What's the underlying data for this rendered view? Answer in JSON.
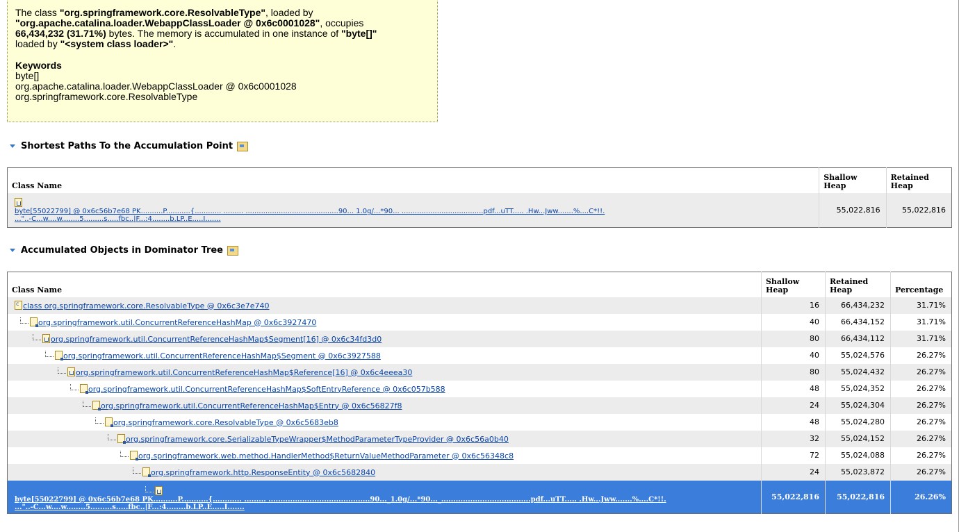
{
  "summary": {
    "p1_a": "The class ",
    "p1_cls": "\"org.springframework.core.ResolvableType\"",
    "p1_b": ", loaded by",
    "p1_loader": "\"org.apache.catalina.loader.WebappClassLoader @ 0x6c0001028\"",
    "p1_c": ", occupies",
    "p1_bytes": "66,434,232 (31.71%)",
    "p1_d": " bytes. The memory is accumulated in one instance of ",
    "p1_type": "\"byte[]\"",
    "p1_e": "loaded by ",
    "p1_syscl": "\"<system class loader>\"",
    "p1_f": ".",
    "keywords_title": "Keywords",
    "keywords": [
      "byte[]",
      "org.apache.catalina.loader.WebappClassLoader @ 0x6c0001028",
      "org.springframework.core.ResolvableType"
    ]
  },
  "shortest_paths": {
    "title": "Shortest Paths To the Accumulation Point",
    "columns": {
      "class_name": "Class Name",
      "shallow": "Shallow Heap",
      "retained": "Retained Heap"
    },
    "row": {
      "line1": "byte[55022799] @ 0x6c56b7e68 PK..........P...........{............ ......... ..........................................90...  1.0g/...*90... .....................................pdf...uTT.....  .Hw...Jww.......%....C*!!.",
      "line2": "...\"..-C...w....w........5.........s.....fbc..|F...:4........b.LP..E.....I.......",
      "shallow": "55,022,816",
      "retained": "55,022,816"
    }
  },
  "dominator": {
    "title": "Accumulated Objects in Dominator Tree",
    "columns": {
      "class_name": "Class Name",
      "shallow": "Shallow Heap",
      "retained": "Retained Heap",
      "percentage": "Percentage"
    },
    "rows": [
      {
        "label": "class org.springframework.core.ResolvableType @ 0x6c3e7e740",
        "shallow": "16",
        "retained": "66,434,232",
        "pct": "31.71%"
      },
      {
        "label": "org.springframework.util.ConcurrentReferenceHashMap @ 0x6c3927470",
        "shallow": "40",
        "retained": "66,434,152",
        "pct": "31.71%"
      },
      {
        "label": "org.springframework.util.ConcurrentReferenceHashMap$Segment[16] @ 0x6c34fd3d0",
        "shallow": "80",
        "retained": "66,434,112",
        "pct": "31.71%"
      },
      {
        "label": "org.springframework.util.ConcurrentReferenceHashMap$Segment @ 0x6c3927588",
        "shallow": "40",
        "retained": "55,024,576",
        "pct": "26.27%"
      },
      {
        "label": "org.springframework.util.ConcurrentReferenceHashMap$Reference[16] @ 0x6c4eeea30",
        "shallow": "80",
        "retained": "55,024,432",
        "pct": "26.27%"
      },
      {
        "label": "org.springframework.util.ConcurrentReferenceHashMap$SoftEntryReference @ 0x6c057b588",
        "shallow": "48",
        "retained": "55,024,352",
        "pct": "26.27%"
      },
      {
        "label": "org.springframework.util.ConcurrentReferenceHashMap$Entry @ 0x6c56827f8",
        "shallow": "24",
        "retained": "55,024,304",
        "pct": "26.27%"
      },
      {
        "label": "org.springframework.core.ResolvableType @ 0x6c5683eb8",
        "shallow": "48",
        "retained": "55,024,280",
        "pct": "26.27%"
      },
      {
        "label": "org.springframework.core.SerializableTypeWrapper$MethodParameterTypeProvider @ 0x6c56a0b40",
        "shallow": "32",
        "retained": "55,024,152",
        "pct": "26.27%"
      },
      {
        "label": "org.springframework.web.method.HandlerMethod$ReturnValueMethodParameter @ 0x6c56348c8",
        "shallow": "72",
        "retained": "55,024,088",
        "pct": "26.27%"
      },
      {
        "label": "org.springframework.http.ResponseEntity @ 0x6c5682840",
        "shallow": "24",
        "retained": "55,023,872",
        "pct": "26.27%"
      }
    ],
    "selected": {
      "line1": "byte[55022799] @ 0x6c56b7e68 PK..........P...........{............ ......... ..........................................90..._1.0g/...*90..._.....................................pdf...uTT.....  .Hw...Jww.......%....C*!!.",
      "line2": "...\"..-C...w....w........5.........s.....fbc..|F...:4........b.LP..E.....I.......",
      "shallow": "55,022,816",
      "retained": "55,022,816",
      "pct": "26.26%"
    }
  }
}
